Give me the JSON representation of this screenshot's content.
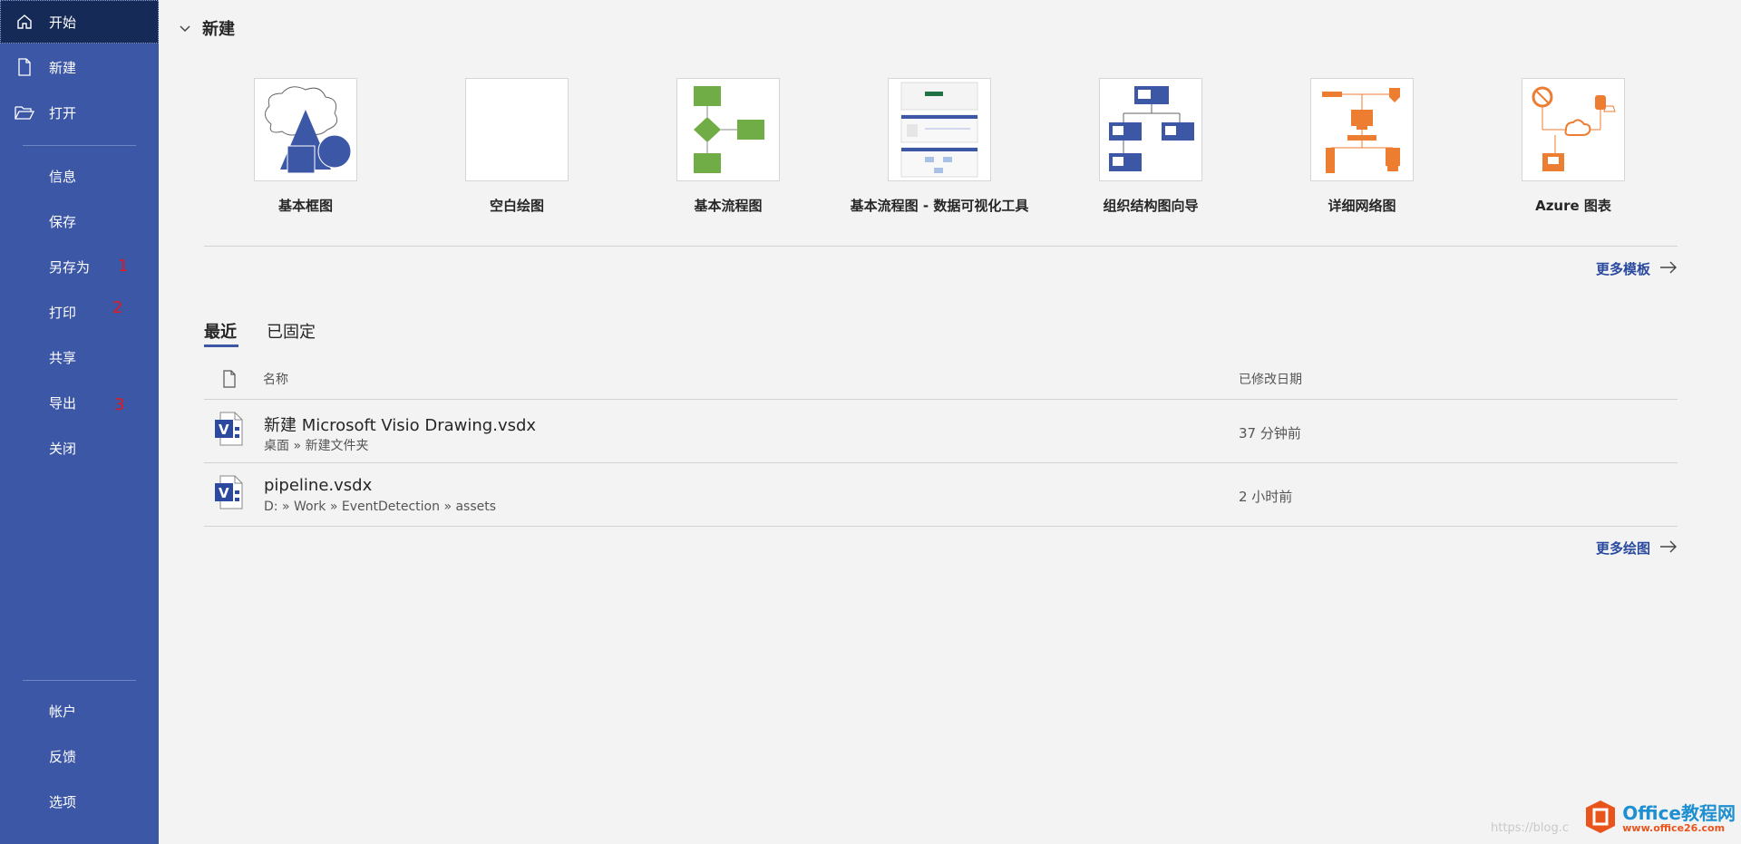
{
  "sidebar": {
    "items": [
      {
        "label": "开始",
        "icon": "home-icon",
        "active": true
      },
      {
        "label": "新建",
        "icon": "new-file-icon"
      },
      {
        "label": "打开",
        "icon": "open-folder-icon"
      }
    ],
    "middle_items": [
      {
        "label": "信息"
      },
      {
        "label": "保存"
      },
      {
        "label": "另存为"
      },
      {
        "label": "打印"
      },
      {
        "label": "共享"
      },
      {
        "label": "导出"
      },
      {
        "label": "关闭"
      }
    ],
    "bottom_items": [
      {
        "label": "帐户"
      },
      {
        "label": "反馈"
      },
      {
        "label": "选项"
      }
    ],
    "annotations": [
      "1",
      "2",
      "3"
    ]
  },
  "new_section": {
    "title": "新建",
    "templates": [
      {
        "name": "基本框图"
      },
      {
        "name": "空白绘图"
      },
      {
        "name": "基本流程图"
      },
      {
        "name": "基本流程图 - 数据可视化工具"
      },
      {
        "name": "组织结构图向导"
      },
      {
        "name": "详细网络图"
      },
      {
        "name": "Azure 图表"
      }
    ],
    "more_templates": "更多模板"
  },
  "recent_section": {
    "tabs": [
      "最近",
      "已固定"
    ],
    "columns": {
      "name": "名称",
      "modified": "已修改日期"
    },
    "files": [
      {
        "name": "新建 Microsoft Visio Drawing.vsdx",
        "path": "桌面 » 新建文件夹",
        "modified": "37 分钟前"
      },
      {
        "name": "pipeline.vsdx",
        "path": "D: » Work » EventDetection » assets",
        "modified": "2 小时前"
      }
    ],
    "more_drawings": "更多绘图"
  },
  "watermark": {
    "url_text": "https://blog.c",
    "brand": "Office教程网",
    "brand_url": "www.office26.com"
  },
  "colors": {
    "sidebar_bg": "#3c57a6",
    "sidebar_active": "#162a57",
    "accent_link": "#2b4a9f",
    "flow_green": "#70ad47",
    "network_orange": "#ed7d31"
  }
}
